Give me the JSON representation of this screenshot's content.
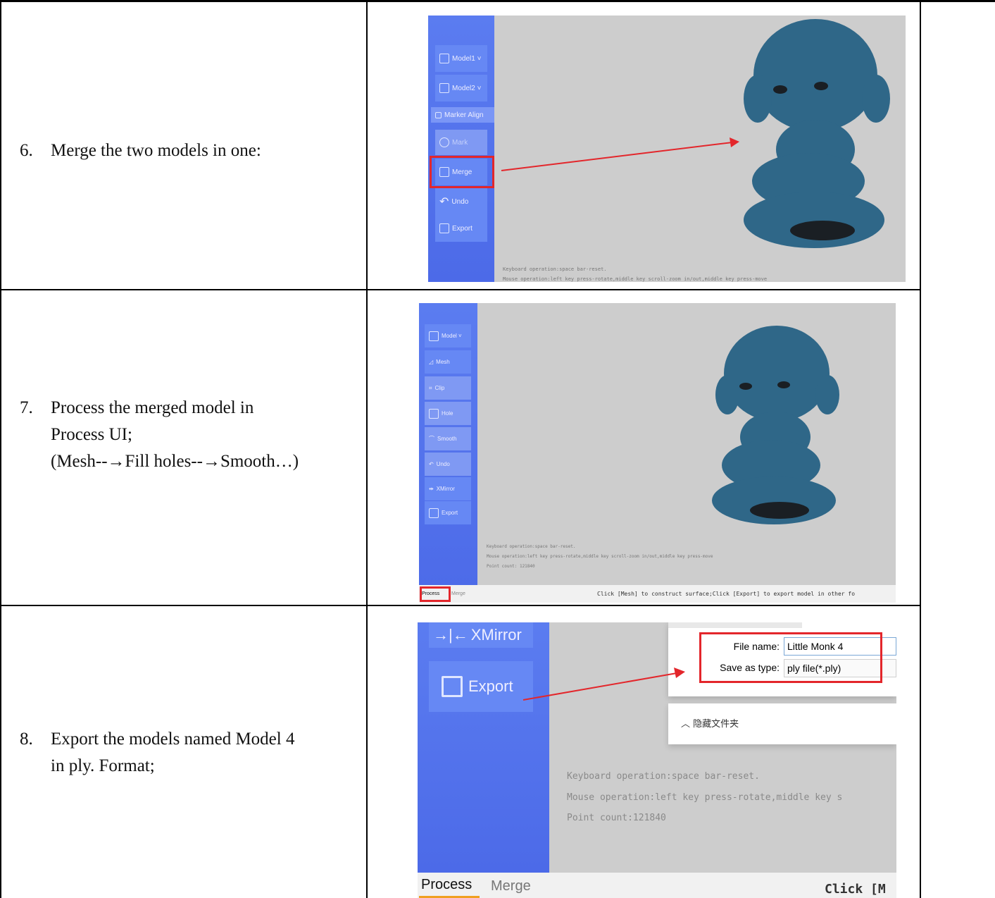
{
  "steps": [
    {
      "num": "6.",
      "line1": "Merge the two models in one:"
    },
    {
      "num": "7.",
      "line1": "Process the merged model in",
      "line2": "Process UI;",
      "line3": "(Mesh--→Fill holes--→Smooth…)"
    },
    {
      "num": "8.",
      "line1": "Export the models named Model 4",
      "line2": "in ply. Format;"
    }
  ],
  "shot1": {
    "buttons": [
      "Model1 ˅",
      "Model2 ˅",
      "Marker Align",
      "Mark",
      "Merge",
      "Undo",
      "Export"
    ],
    "hint1": "Keyboard operation:space bar-reset.",
    "hint2": "Mouse operation:left key press-rotate,middle key scroll-zoom in/out,middle key press-move"
  },
  "shot2": {
    "buttons": [
      "Model ˅",
      "Mesh",
      "Clip",
      "Hole",
      "Smooth",
      "Undo",
      "XMirror",
      "Export"
    ],
    "hint1": "Keyboard operation:space bar-reset.",
    "hint2": "Mouse operation:left key press-rotate,middle key scroll-zoom in/out,middle key press-move",
    "hint3": "Point count: 121840",
    "tab_process": "Process",
    "tab_merge": "Merge",
    "status": "Click [Mesh] to construct surface;Click [Export] to export model in other fo"
  },
  "shot3": {
    "xmirror": "XMirror",
    "export": "Export",
    "file_name_label": "File name:",
    "file_name_value": "Little Monk 4",
    "save_type_label": "Save as type:",
    "save_type_value": "ply file(*.ply)",
    "hide_folders": "隐藏文件夹",
    "hint1": "Keyboard operation:space bar-reset.",
    "hint2": "Mouse operation:left key press-rotate,middle key s",
    "hint3": "Point count:121840",
    "tab_process": "Process",
    "tab_merge": "Merge",
    "status": "Click [M"
  },
  "colors": {
    "sidebar": "#5b7cf0",
    "button": "#6688f4",
    "viewport": "#cdcdcd",
    "model": "#2f6788",
    "highlight": "#e3262b"
  }
}
